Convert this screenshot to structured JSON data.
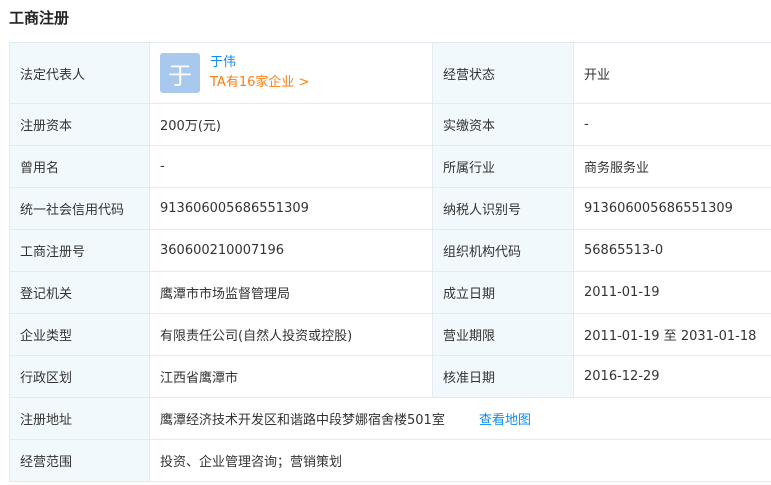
{
  "section_title": "工商注册",
  "legal_rep": {
    "label": "法定代表人",
    "avatar_char": "于",
    "name": "于伟",
    "companies_link": "TA有16家企业 >"
  },
  "rows": [
    {
      "k1": "经营状态",
      "v1": "开业"
    },
    {
      "k1": "注册资本",
      "v1": "200万(元)",
      "k2": "实缴资本",
      "v2": "-"
    },
    {
      "k1": "曾用名",
      "v1": "-",
      "k2": "所属行业",
      "v2": "商务服务业"
    },
    {
      "k1": "统一社会信用代码",
      "v1": "913606005686551309",
      "k2": "纳税人识别号",
      "v2": "913606005686551309"
    },
    {
      "k1": "工商注册号",
      "v1": "360600210007196",
      "k2": "组织机构代码",
      "v2": "56865513-0"
    },
    {
      "k1": "登记机关",
      "v1": "鹰潭市市场监督管理局",
      "k2": "成立日期",
      "v2": "2011-01-19"
    },
    {
      "k1": "企业类型",
      "v1": "有限责任公司(自然人投资或控股)",
      "k2": "营业期限",
      "v2": "2011-01-19 至 2031-01-18"
    },
    {
      "k1": "行政区划",
      "v1": "江西省鹰潭市",
      "k2": "核准日期",
      "v2": "2016-12-29"
    }
  ],
  "address": {
    "label": "注册地址",
    "value": "鹰潭经济技术开发区和谐路中段梦娜宿舍楼501室",
    "map_link": "查看地图"
  },
  "scope": {
    "label": "经营范围",
    "value": "投资、企业管理咨询；营销策划"
  }
}
